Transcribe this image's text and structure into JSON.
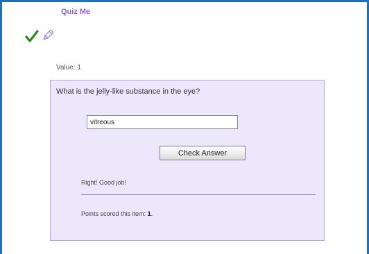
{
  "quiz": {
    "title": "Quiz Me",
    "value_label": "Value: 1",
    "question": "What is the jelly-like substance in the eye?",
    "answer_value": "vitreous",
    "check_button_label": "Check Answer",
    "feedback": "Right! Good job!",
    "points_prefix": "Points scored this item:",
    "points_value": "1",
    "points_suffix": "."
  },
  "icons": {
    "check": "checkmark-icon",
    "pencil": "pencil-icon"
  },
  "colors": {
    "frame_border": "#1f6fb8",
    "title": "#8a63cc",
    "panel_background": "#ece7fb",
    "panel_border": "#b6a6e6",
    "checkmark": "#2c8a1e"
  }
}
